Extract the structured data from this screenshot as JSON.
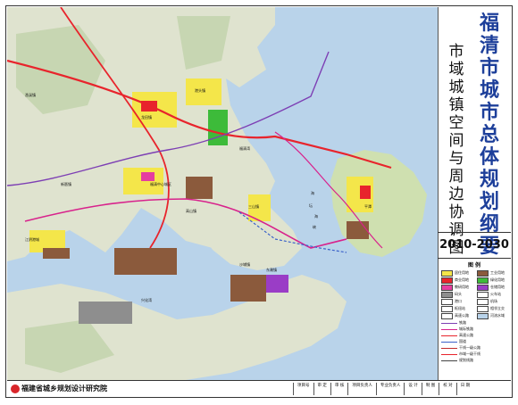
{
  "title": {
    "main": "福清市城市总体规划纲要",
    "sub": "市域城镇空间与周边协调图",
    "year": "2010-2030"
  },
  "institute": "福建省城乡规划设计研究院",
  "signature_cells": [
    "项目号",
    "审 定",
    "审 核",
    "项目负责人",
    "专业负责人",
    "设 计",
    "制 图",
    "校 对",
    "日 期"
  ],
  "map_labels": {
    "bay_fuqing": "福清湾",
    "bay_xinghua": "兴化湾",
    "strait_1": "海",
    "strait_2": "坛",
    "strait_3": "海",
    "strait_4": "峡",
    "city_center": "福清中心城区",
    "city_left": "江阴港城",
    "town_1": "龙田镇",
    "town_2": "港头镇",
    "town_3": "高山镇",
    "town_4": "三山镇",
    "town_5": "沙埔镇",
    "town_6": "东瀚镇",
    "town_7": "新厝镇",
    "town_8": "渔溪镇",
    "town_9": "平潭"
  },
  "legend": {
    "title": "图 例",
    "items": [
      {
        "label": "居住用地",
        "color": "#f4e64a"
      },
      {
        "label": "工业用地",
        "color": "#8b5a3c"
      },
      {
        "label": "商业用地",
        "color": "#e8242c"
      },
      {
        "label": "绿化用地",
        "color": "#3dbb3a"
      },
      {
        "label": "教研用地",
        "color": "#e53ea0"
      },
      {
        "label": "仓储用地",
        "color": "#9a3dc6"
      },
      {
        "label": "码头",
        "color": "#8e8e8e"
      },
      {
        "label": "火车站",
        "color": "#ffffff"
      },
      {
        "label": "港口",
        "color": "#ffffff"
      },
      {
        "label": "机场",
        "color": "#ffffff"
      },
      {
        "label": "枢纽站",
        "color": "#ffffff"
      },
      {
        "label": "相邻立交",
        "color": "#ffffff"
      },
      {
        "label": "高速公路",
        "color": "#ffffff"
      },
      {
        "label": "河流水域",
        "color": "#b9d3ea"
      }
    ],
    "lines": [
      {
        "label": "铁路",
        "color": "#7d3fb4"
      },
      {
        "label": "城际铁路",
        "color": "#d8228c"
      },
      {
        "label": "高速公路",
        "color": "#e8242c"
      },
      {
        "label": "国道",
        "color": "#3a61c9"
      },
      {
        "label": "干线一级公路",
        "color": "#c02a2a"
      },
      {
        "label": "市域一级干线",
        "color": "#e8242c"
      },
      {
        "label": "规划线路",
        "color": "#444444"
      }
    ]
  }
}
